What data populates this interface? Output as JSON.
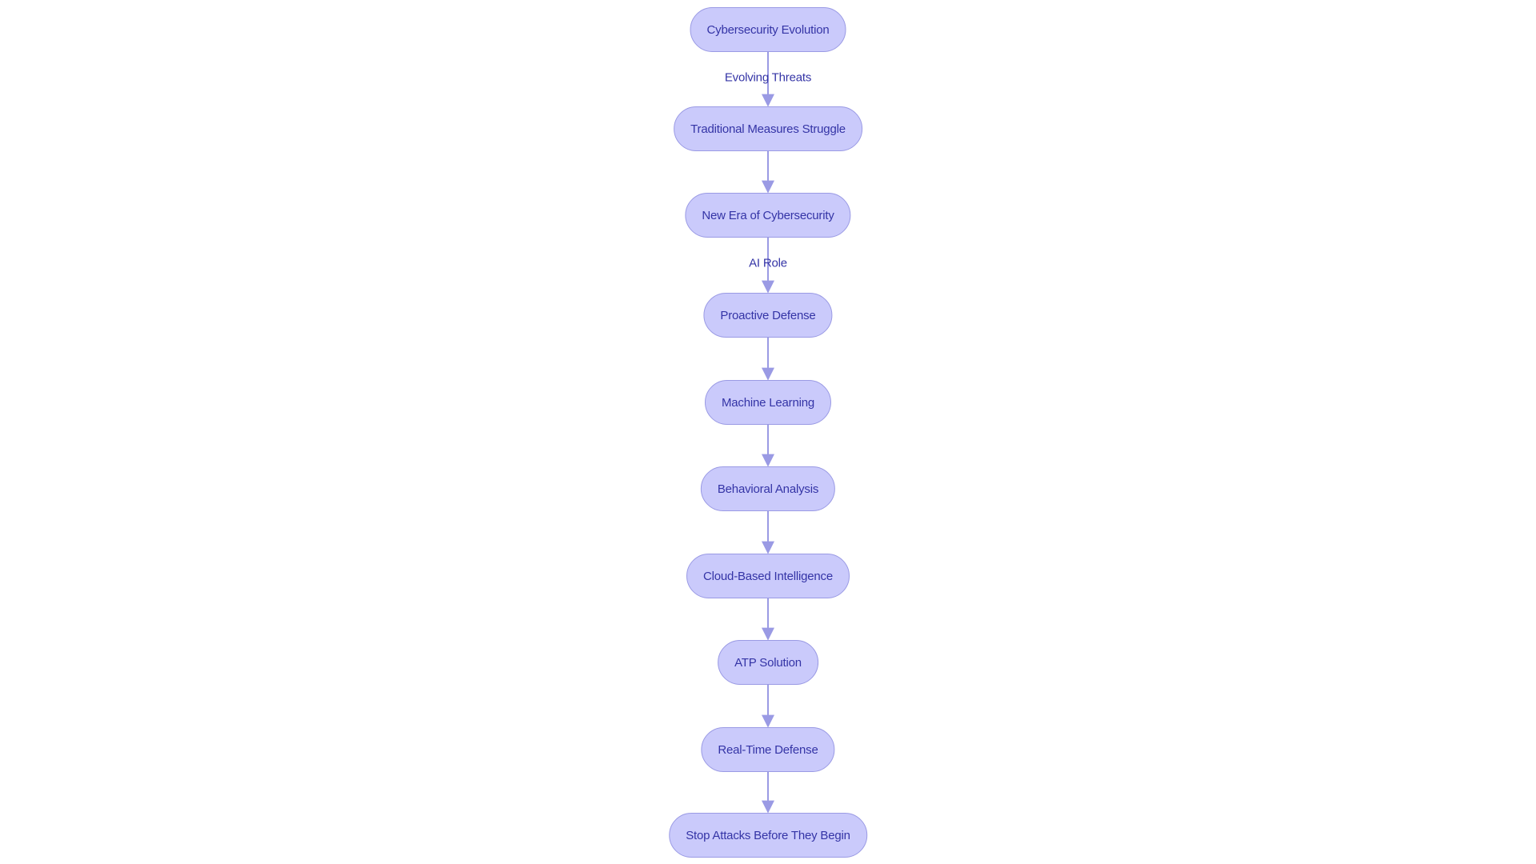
{
  "diagram": {
    "type": "flowchart",
    "direction": "top-to-bottom",
    "colors": {
      "node_fill": "#CACAFB",
      "node_border": "#9A9AE4",
      "text": "#3434A6",
      "edge": "#9A9AE4",
      "background": "#FFFFFF"
    },
    "nodes": [
      {
        "id": "n1",
        "label": "Cybersecurity Evolution"
      },
      {
        "id": "n2",
        "label": "Traditional Measures Struggle"
      },
      {
        "id": "n3",
        "label": "New Era of Cybersecurity"
      },
      {
        "id": "n4",
        "label": "Proactive Defense"
      },
      {
        "id": "n5",
        "label": "Machine Learning"
      },
      {
        "id": "n6",
        "label": "Behavioral Analysis"
      },
      {
        "id": "n7",
        "label": "Cloud-Based Intelligence"
      },
      {
        "id": "n8",
        "label": "ATP Solution"
      },
      {
        "id": "n9",
        "label": "Real-Time Defense"
      },
      {
        "id": "n10",
        "label": "Stop Attacks Before They Begin"
      }
    ],
    "edges": [
      {
        "from": "n1",
        "to": "n2",
        "label": "Evolving Threats"
      },
      {
        "from": "n2",
        "to": "n3",
        "label": ""
      },
      {
        "from": "n3",
        "to": "n4",
        "label": "AI Role"
      },
      {
        "from": "n4",
        "to": "n5",
        "label": ""
      },
      {
        "from": "n5",
        "to": "n6",
        "label": ""
      },
      {
        "from": "n6",
        "to": "n7",
        "label": ""
      },
      {
        "from": "n7",
        "to": "n8",
        "label": ""
      },
      {
        "from": "n8",
        "to": "n9",
        "label": ""
      },
      {
        "from": "n9",
        "to": "n10",
        "label": ""
      }
    ]
  }
}
